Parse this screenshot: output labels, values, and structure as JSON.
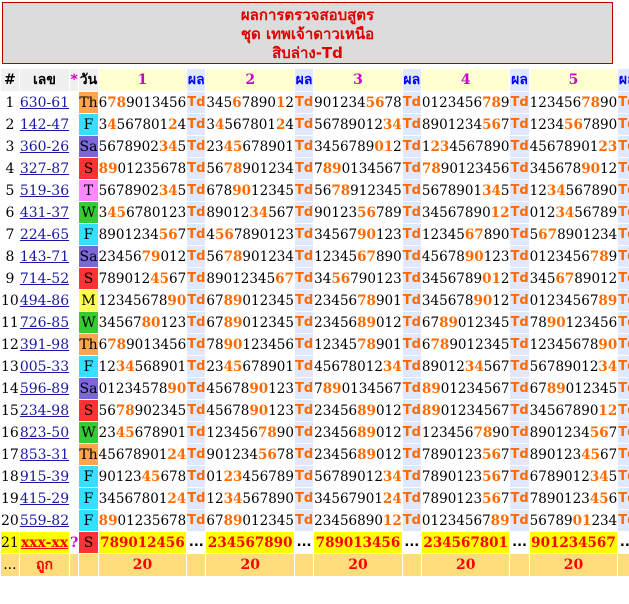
{
  "header": {
    "line1": "ผลการตรวจสอบสูตร",
    "line2": "ชุด เทพเจ้าดาวเหนือ",
    "line3": "สิบล่าง-Td"
  },
  "columns": {
    "hash": "#",
    "number": "เลข",
    "star": "*",
    "day": "วัน",
    "formulas": [
      "1",
      "2",
      "3",
      "4",
      "5"
    ],
    "result": "ผล"
  },
  "day_colors": {
    "Th": "#ffa54d",
    "F": "#33e0ff",
    "Sa": "#7b68d8",
    "S": "#ff3333",
    "T": "#ff88ff",
    "W": "#33cc33",
    "M": "#ffff55"
  },
  "rows": [
    {
      "idx": "1",
      "num": "630-61",
      "day": "Th",
      "seqs": [
        "6789013456",
        "3456789012",
        "9012345678",
        "0123456789",
        "1234567890"
      ],
      "res": "Td"
    },
    {
      "idx": "2",
      "num": "142-47",
      "day": "F",
      "seqs": [
        "3456780124",
        "3456780124",
        "5678901234",
        "8901234567",
        "1234567890"
      ],
      "res": "Td"
    },
    {
      "idx": "3",
      "num": "360-26",
      "day": "Sa",
      "seqs": [
        "5678902345",
        "2345678901",
        "3456789012",
        "1234567890",
        "4567890123"
      ],
      "res": "Td"
    },
    {
      "idx": "4",
      "num": "327-87",
      "day": "S",
      "seqs": [
        "8901235678",
        "5678901234",
        "7890134567",
        "7890123456",
        "3456789012"
      ],
      "res": "Td"
    },
    {
      "idx": "5",
      "num": "519-36",
      "day": "T",
      "seqs": [
        "5678902345",
        "6789012345",
        "5678912345",
        "5678901345",
        "1234567890"
      ],
      "res": "Td"
    },
    {
      "idx": "6",
      "num": "431-37",
      "day": "W",
      "seqs": [
        "3456780123",
        "8901234567",
        "9012356789",
        "3456789012",
        "0123456789"
      ],
      "res": "Td"
    },
    {
      "idx": "7",
      "num": "224-65",
      "day": "F",
      "seqs": [
        "8901234567",
        "4567890123",
        "3456790123",
        "1234567890",
        "5678901234"
      ],
      "res": "Td"
    },
    {
      "idx": "8",
      "num": "143-71",
      "day": "Sa",
      "seqs": [
        "2345679012",
        "5678901234",
        "1234567890",
        "4567890123",
        "0123456789"
      ],
      "res": "Td"
    },
    {
      "idx": "9",
      "num": "714-52",
      "day": "S",
      "seqs": [
        "7890124567",
        "8901234567",
        "3456790123",
        "3456789012",
        "3456789012"
      ],
      "res": "Td"
    },
    {
      "idx": "10",
      "num": "494-86",
      "day": "M",
      "seqs": [
        "1234567890",
        "6789012345",
        "2345678901",
        "3456789012",
        "0123456789"
      ],
      "res": "Td"
    },
    {
      "idx": "11",
      "num": "726-85",
      "day": "W",
      "seqs": [
        "3456780123",
        "6789012345",
        "2345689012",
        "6789012345",
        "7890123456"
      ],
      "res": "Td"
    },
    {
      "idx": "12",
      "num": "391-98",
      "day": "Th",
      "seqs": [
        "6789013456",
        "7890123456",
        "1234578901",
        "6789012345",
        "1234567890"
      ],
      "res": "Td"
    },
    {
      "idx": "13",
      "num": "005-33",
      "day": "F",
      "seqs": [
        "1234568901",
        "2345678901",
        "4567801234",
        "8901234567",
        "5678901234"
      ],
      "res": "Td"
    },
    {
      "idx": "14",
      "num": "596-89",
      "day": "Sa",
      "seqs": [
        "0123457890",
        "4567890123",
        "7890134567",
        "8901234567",
        "6789012345"
      ],
      "res": "Td"
    },
    {
      "idx": "15",
      "num": "234-98",
      "day": "S",
      "seqs": [
        "5678902345",
        "4567890123",
        "2345689012",
        "8901234567",
        "3456789012"
      ],
      "res": "Td"
    },
    {
      "idx": "16",
      "num": "823-50",
      "day": "W",
      "seqs": [
        "2345678901",
        "1234567890",
        "2345689012",
        "1234567890",
        "8901234567"
      ],
      "res": "Td"
    },
    {
      "idx": "17",
      "num": "853-31",
      "day": "Th",
      "seqs": [
        "4567890124",
        "9012345678",
        "2345689012",
        "7890123567",
        "8901234567"
      ],
      "res": "Td"
    },
    {
      "idx": "18",
      "num": "915-39",
      "day": "F",
      "seqs": [
        "9012345678",
        "0123456789",
        "5678901234",
        "7890123567",
        "6789012345"
      ],
      "res": "Td"
    },
    {
      "idx": "19",
      "num": "415-29",
      "day": "F",
      "seqs": [
        "3456780124",
        "1234567890",
        "3456790124",
        "7890123567",
        "7890123456"
      ],
      "res": "Td"
    },
    {
      "idx": "20",
      "num": "559-82",
      "day": "F",
      "seqs": [
        "8901235678",
        "6789012345",
        "2345689012",
        "0123456789",
        "5678901234"
      ],
      "res": "Td"
    }
  ],
  "highlights": [
    [
      [
        1,
        2
      ],
      [
        3,
        8
      ],
      [
        6,
        7
      ],
      [
        7,
        8
      ],
      [
        6,
        7
      ]
    ],
    [
      [
        1,
        8
      ],
      [
        1,
        8
      ],
      [
        8,
        9
      ],
      [
        7,
        8
      ],
      [
        4,
        5
      ]
    ],
    [
      [
        7,
        8
      ],
      [
        2,
        3
      ],
      [
        7,
        8
      ],
      [
        1,
        2
      ],
      [
        8,
        9
      ]
    ],
    [
      [
        0,
        1
      ],
      [
        2,
        3
      ],
      [
        1,
        2
      ],
      [
        0,
        1
      ],
      [
        6,
        7
      ]
    ],
    [
      [
        7,
        8
      ],
      [
        3,
        4
      ],
      [
        2,
        3
      ],
      [
        7,
        8
      ],
      [
        2,
        3
      ]
    ],
    [
      [
        1,
        2
      ],
      [
        5,
        6
      ],
      [
        5,
        6
      ],
      [
        8,
        9
      ],
      [
        3,
        4
      ]
    ],
    [
      [
        7,
        8
      ],
      [
        1,
        2
      ],
      [
        5,
        6
      ],
      [
        5,
        6
      ],
      [
        1,
        2
      ]
    ],
    [
      [
        5,
        6
      ],
      [
        2,
        3
      ],
      [
        5,
        6
      ],
      [
        5,
        6
      ],
      [
        7,
        8
      ]
    ],
    [
      [
        6,
        7
      ],
      [
        8,
        9
      ],
      [
        2,
        3
      ],
      [
        7,
        8
      ],
      [
        3,
        4
      ]
    ],
    [
      [
        8,
        9
      ],
      [
        2,
        3
      ],
      [
        5,
        6
      ],
      [
        6,
        7
      ],
      [
        8,
        9
      ]
    ],
    [
      [
        5,
        6
      ],
      [
        2,
        3
      ],
      [
        5,
        6
      ],
      [
        2,
        3
      ],
      [
        2,
        3
      ]
    ],
    [
      [
        1,
        2
      ],
      [
        2,
        3
      ],
      [
        5,
        6
      ],
      [
        1,
        2
      ],
      [
        8,
        9
      ]
    ],
    [
      [
        2,
        3
      ],
      [
        2,
        3
      ],
      [
        8,
        9
      ],
      [
        5,
        6
      ],
      [
        8,
        9
      ]
    ],
    [
      [
        8,
        9
      ],
      [
        5,
        6
      ],
      [
        1,
        2
      ],
      [
        0,
        1
      ],
      [
        2,
        3
      ]
    ],
    [
      [
        2,
        3
      ],
      [
        5,
        6
      ],
      [
        5,
        6
      ],
      [
        0,
        1
      ],
      [
        8,
        9
      ]
    ],
    [
      [
        2,
        3
      ],
      [
        6,
        7
      ],
      [
        5,
        6
      ],
      [
        6,
        7
      ],
      [
        7,
        8
      ]
    ],
    [
      [
        8,
        9
      ],
      [
        6,
        7
      ],
      [
        5,
        6
      ],
      [
        7,
        8
      ],
      [
        6,
        7
      ]
    ],
    [
      [
        5,
        6
      ],
      [
        2,
        3
      ],
      [
        8,
        9
      ],
      [
        7,
        8
      ],
      [
        7,
        8
      ]
    ],
    [
      [
        8,
        9
      ],
      [
        2,
        3
      ],
      [
        8,
        9
      ],
      [
        7,
        8
      ],
      [
        7,
        8
      ]
    ],
    [
      [
        0,
        1
      ],
      [
        2,
        3
      ],
      [
        8,
        9
      ],
      [
        8,
        9
      ],
      [
        5,
        6
      ]
    ]
  ],
  "summary": {
    "idx": "21",
    "num": "xxx-xx",
    "star": "?",
    "day": "S",
    "seqs": [
      "789012456",
      "234567890",
      "789013456",
      "234567801",
      "901234567"
    ],
    "dots": "..."
  },
  "footer": {
    "dots": "...",
    "label": "ถูก",
    "counts": [
      "20",
      "20",
      "20",
      "20",
      "20"
    ]
  }
}
